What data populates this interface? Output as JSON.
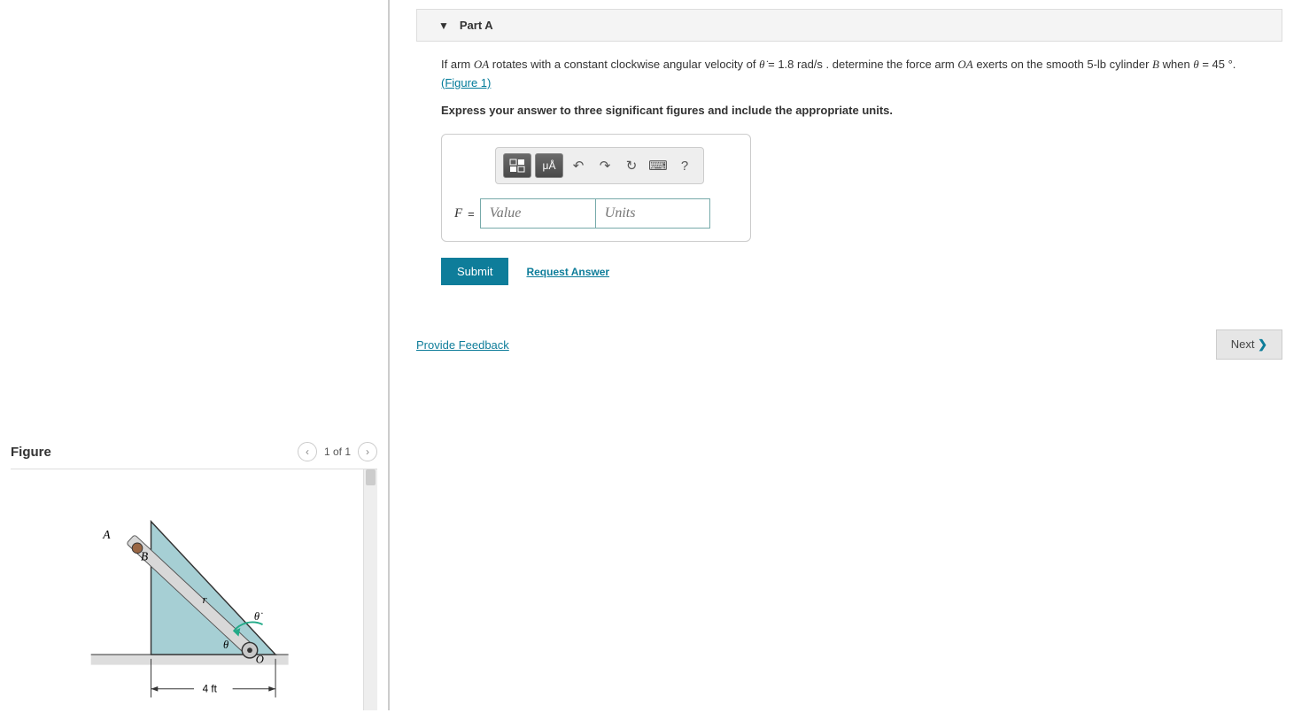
{
  "partHeader": {
    "label": "Part A"
  },
  "problem": {
    "text_before_thetadot": "If arm ",
    "arm": "OA",
    "text2": " rotates with a constant clockwise angular velocity of ",
    "thetadot_sym": "θ̇",
    "thetadot_val": " = 1.8 rad/s",
    "text3": " . determine the force arm ",
    "arm2": "OA",
    "text4": " exerts on the smooth 5-lb cylinder ",
    "bvar": "B",
    "text5": " when ",
    "theta": "θ",
    "thetaval": " = 45 °.",
    "figlink": "(Figure 1)",
    "instruction": "Express your answer to three significant figures and include the appropriate units."
  },
  "toolbar": {
    "templates": "▫▪",
    "specialchars": "μÅ",
    "undo": "↶",
    "redo": "↷",
    "reset": "↻",
    "keyboard": "⌨",
    "help": "?"
  },
  "input": {
    "var": "F",
    "eq": " = ",
    "value_placeholder": "Value",
    "units_placeholder": "Units"
  },
  "buttons": {
    "submit": "Submit",
    "request": "Request Answer",
    "feedback": "Provide Feedback",
    "next": "Next"
  },
  "figure": {
    "title": "Figure",
    "counter": "1 of 1",
    "labels": {
      "A": "A",
      "B": "B",
      "r": "r",
      "theta": "θ",
      "thetadot": "θ̇",
      "O": "O",
      "dim": "4 ft"
    }
  }
}
